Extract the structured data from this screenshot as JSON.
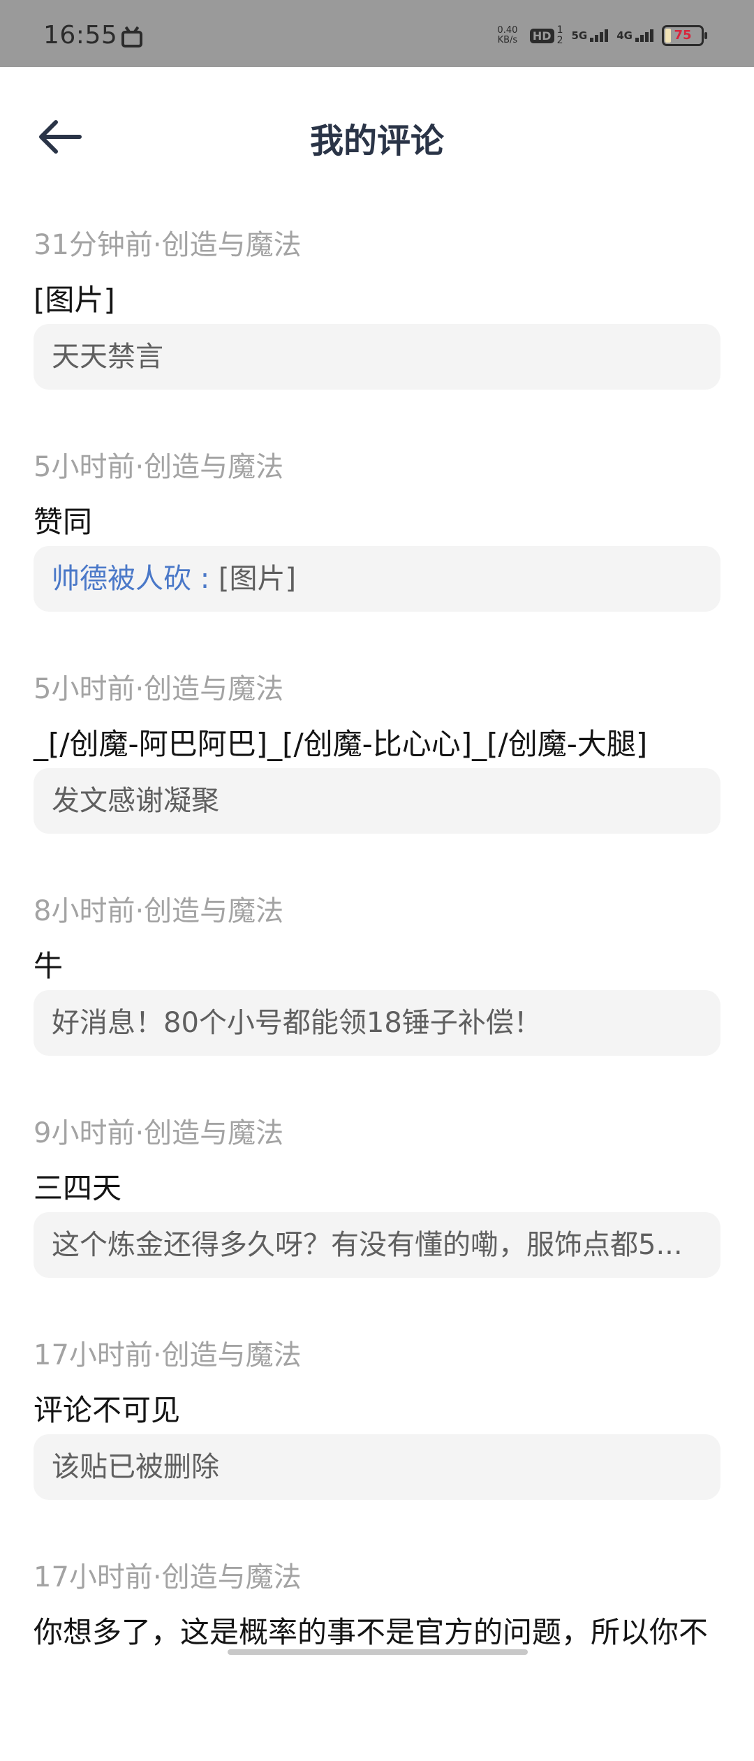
{
  "status_bar": {
    "time": "16:55",
    "net_speed_value": "0.40",
    "net_speed_unit": "KB/s",
    "hd_label": "HD",
    "hd_sub": "1\n2",
    "net1_label": "5G",
    "net2_label": "4G",
    "battery": "75"
  },
  "header": {
    "title": "我的评论"
  },
  "comments": [
    {
      "meta": "31分钟前·创造与魔法",
      "text": "[图片]",
      "quote_user": "",
      "quote_text": "天天禁言"
    },
    {
      "meta": "5小时前·创造与魔法",
      "text": "赞同",
      "quote_user": "帅德被人砍 : ",
      "quote_text": "[图片]"
    },
    {
      "meta": "5小时前·创造与魔法",
      "text": "_[/创魔-阿巴阿巴]_[/创魔-比心心]_[/创魔-大腿]",
      "quote_user": "",
      "quote_text": "发文感谢凝聚"
    },
    {
      "meta": "8小时前·创造与魔法",
      "text": "牛",
      "quote_user": "",
      "quote_text": "好消息！80个小号都能领18锤子补偿！"
    },
    {
      "meta": "9小时前·创造与魔法",
      "text": "三四天",
      "quote_user": "",
      "quote_text": "这个炼金还得多久呀？有没有懂的嘞，服饰点都5..."
    },
    {
      "meta": "17小时前·创造与魔法",
      "text": "评论不可见",
      "quote_user": "",
      "quote_text": "该贴已被删除"
    },
    {
      "meta": "17小时前·创造与魔法",
      "text": "你想多了，这是概率的事不是官方的问题，所以你不",
      "quote_user": "",
      "quote_text": ""
    }
  ]
}
